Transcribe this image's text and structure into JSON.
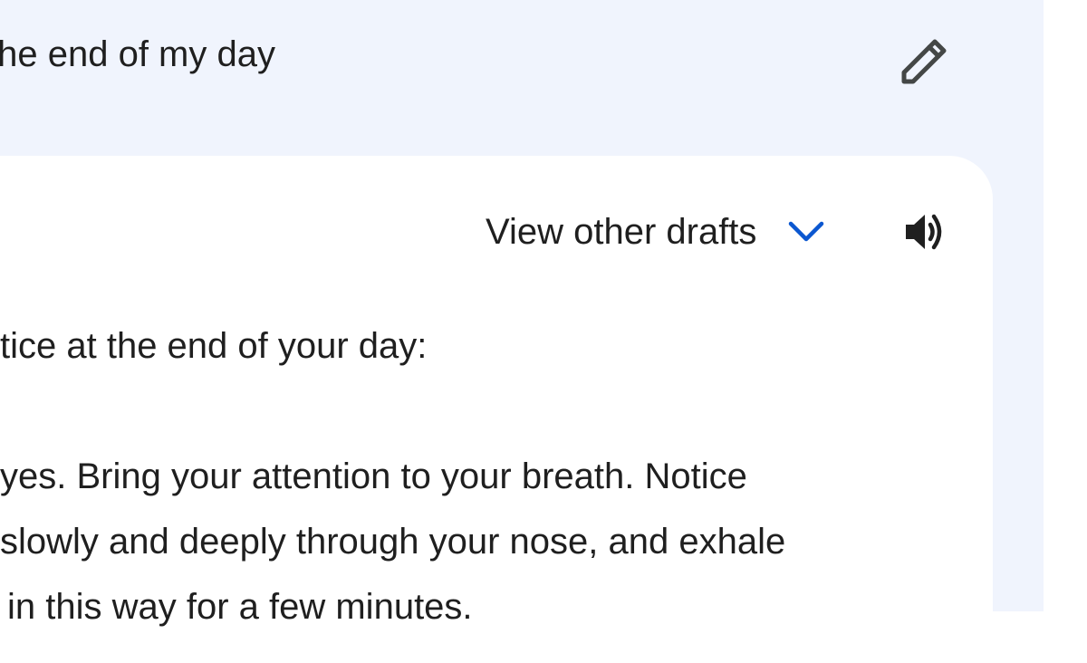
{
  "prompt": {
    "text": "the end of my day",
    "edit_icon": "pencil-icon"
  },
  "response_header": {
    "drafts_label": "View other drafts",
    "drafts_icon": "chevron-down-icon",
    "speaker_icon": "volume-icon"
  },
  "response": {
    "lines": [
      "tice at the end of your day:",
      "yes. Bring your attention to your breath. Notice",
      "slowly and deeply through your nose, and exhale",
      "in this way for a few minutes."
    ]
  },
  "colors": {
    "background": "#f0f4fd",
    "card": "#ffffff",
    "text": "#1f1f1f",
    "accent": "#0b57d0",
    "icon": "#444746"
  }
}
